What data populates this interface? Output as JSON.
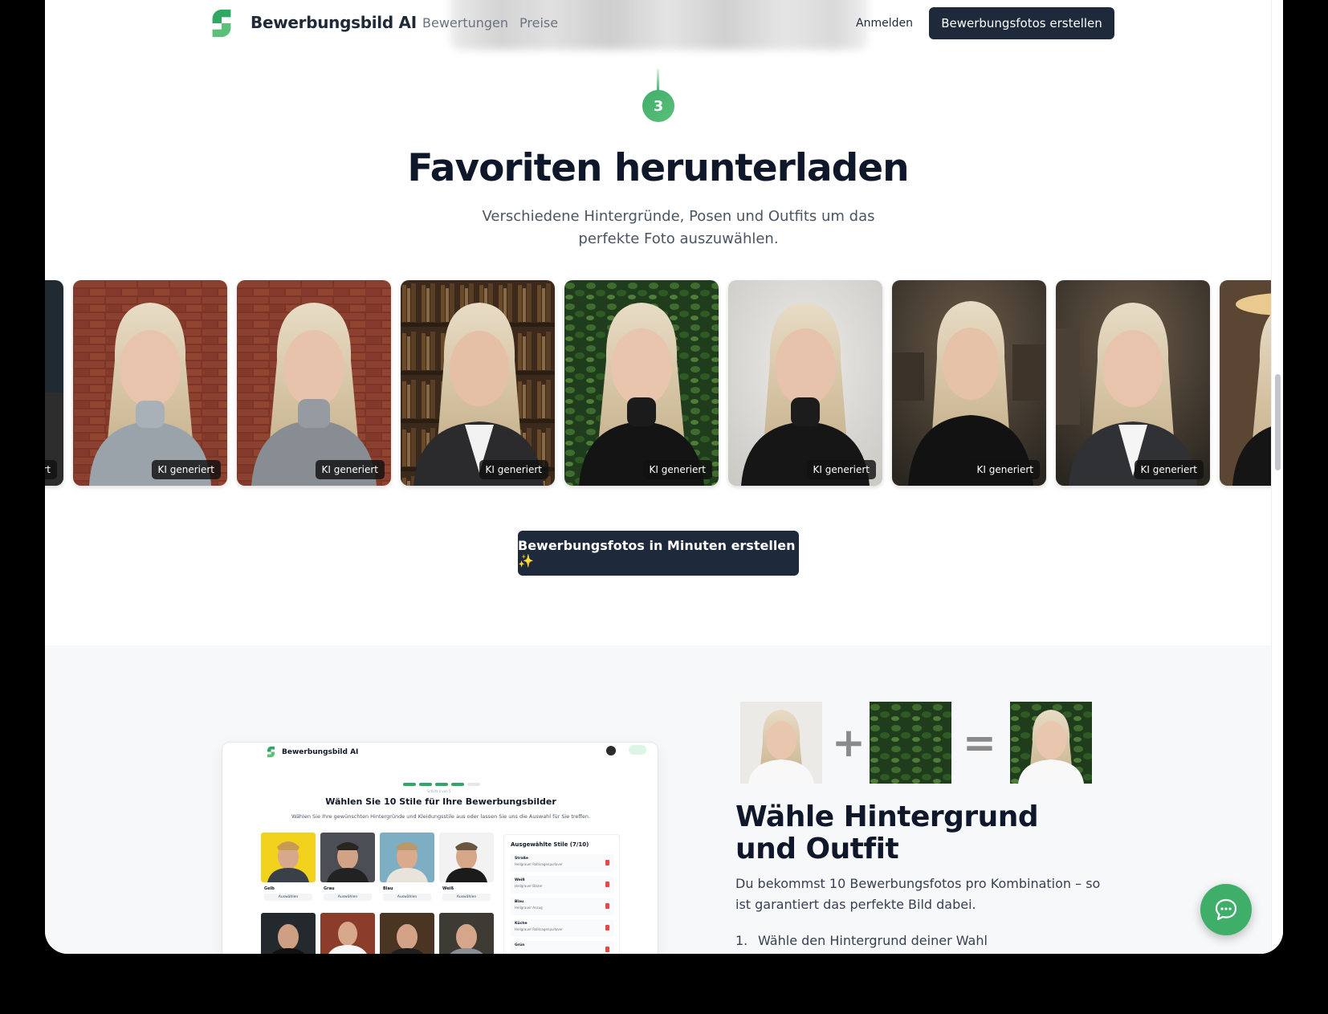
{
  "nav": {
    "brand": "Bewerbungsbild AI",
    "links": [
      "Bewertungen",
      "Preise"
    ],
    "login": "Anmelden",
    "cta": "Bewerbungsfotos erstellen"
  },
  "step": {
    "number": "3",
    "title": "Favoriten herunterladen",
    "subtitle": "Verschiedene Hintergründe, Posen und Outfits um das perfekte Foto auszuwählen."
  },
  "gallery": {
    "first_tag_partial": "rt",
    "tag": "KI generiert",
    "backgrounds": [
      "brick-wall",
      "brick-wall",
      "bookshelf",
      "green-leaves",
      "plain-light",
      "office",
      "office",
      "cafe"
    ],
    "colors": {
      "brand_green": "#3fae69",
      "dark_button": "#1e293b"
    }
  },
  "main_cta": "Bewerbungsfotos in Minuten erstellen ✨",
  "mockup": {
    "brand": "Bewerbungsbild AI",
    "progress": "Schritt 4 von 5",
    "title": "Wählen Sie 10 Stile für Ihre Bewerbungsbilder",
    "subtitle": "Wählen Sie Ihre gewünschten Hintergründe und Kleidungsstile aus oder lassen Sie uns die Auswahl für Sie treffen.",
    "tiles": [
      {
        "label": "Gelb",
        "button": "Auswählen"
      },
      {
        "label": "Grau",
        "button": "Auswählen"
      },
      {
        "label": "Blau",
        "button": "Auswählen"
      },
      {
        "label": "Weiß",
        "button": "Auswählen"
      }
    ],
    "panel_title": "Ausgewählte Stile (7/10)",
    "selected": [
      {
        "name": "Straße",
        "desc": "Hellgrauer Rollkragenpullover"
      },
      {
        "name": "Weiß",
        "desc": "Hellgrauer Blazer"
      },
      {
        "name": "Blau",
        "desc": "Hellgrauer Anzug"
      },
      {
        "name": "Küche",
        "desc": "Hellgrauer Rollkragenpullover"
      },
      {
        "name": "Grün",
        "desc": ""
      }
    ]
  },
  "feature": {
    "plus": "+",
    "equals": "=",
    "title": "Wähle Hintergrund und Outfit",
    "text": "Du bekommst 10 Bewerbungsfotos pro Kombination – so ist garantiert das perfekte Bild dabei.",
    "list_number": "1.",
    "list_item": "Wähle den Hintergrund deiner Wahl"
  },
  "icons": [
    "logo-icon",
    "chat-icon",
    "trash-icon"
  ]
}
